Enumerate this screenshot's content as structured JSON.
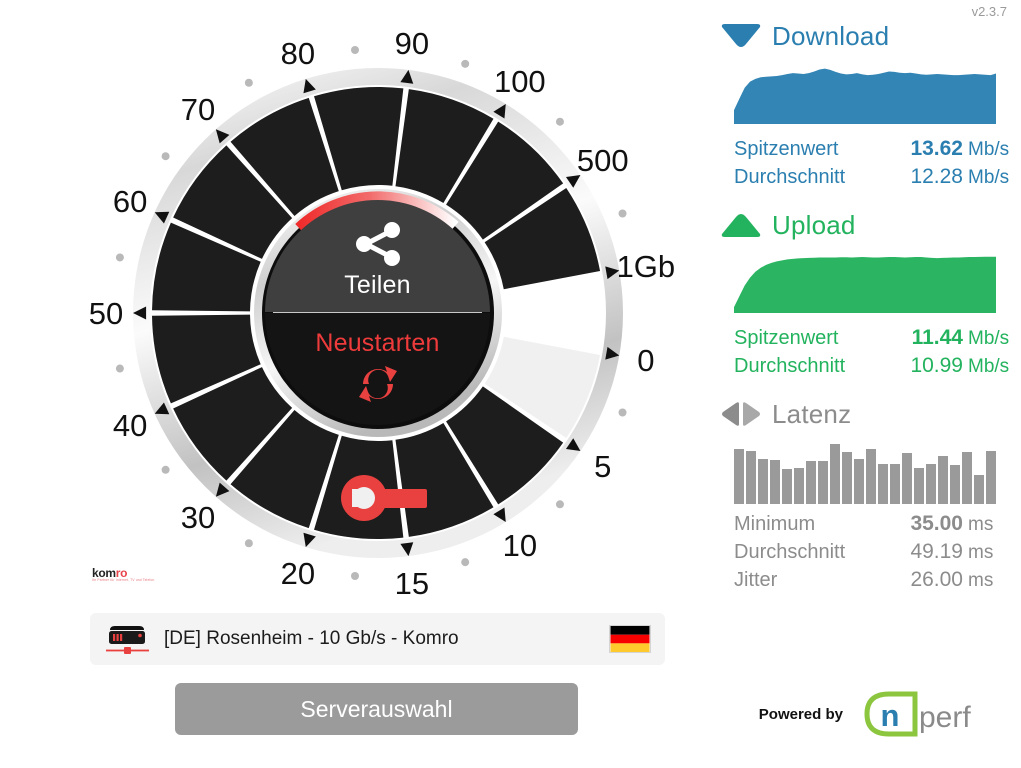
{
  "app": {
    "version": "v2.3.7",
    "powered_by_label": "Powered by",
    "brand_name": "nperf",
    "brand_n": "n",
    "brand_perf": "perf",
    "operator_logo_main": "kom",
    "operator_logo_accent": "ro",
    "operator_logo_tagline": "Ihr Partner für Internet, TV und Telefon"
  },
  "colors": {
    "download": "#2b7fb0",
    "download_fill": "#3385b5",
    "upload": "#23b35e",
    "upload_fill": "#2bb562",
    "latency": "#8c8c8c",
    "latency_fill": "#9a9a9a",
    "accent_red": "#ef3b3b",
    "button_grey": "#9b9b9b",
    "dial_dark": "#1d1d1d",
    "dial_light": "#f0f0f0"
  },
  "gauge": {
    "share_label": "Teilen",
    "share_icon": "share-icon",
    "restart_label": "Neustarten",
    "restart_icon": "refresh-icon",
    "settings_icon": "wrench-icon",
    "scale_labels": [
      "0",
      "5",
      "10",
      "15",
      "20",
      "30",
      "40",
      "50",
      "60",
      "70",
      "80",
      "90",
      "100",
      "500",
      "1Gb"
    ],
    "needle_value_label": ""
  },
  "results": {
    "download": {
      "title": "Download",
      "icon": "download-triangle-icon",
      "peak_label": "Spitzenwert",
      "peak_value": "13.62",
      "peak_unit": "Mb/s",
      "avg_label": "Durchschnitt",
      "avg_value": "12.28",
      "avg_unit": "Mb/s"
    },
    "upload": {
      "title": "Upload",
      "icon": "upload-triangle-icon",
      "peak_label": "Spitzenwert",
      "peak_value": "11.44",
      "peak_unit": "Mb/s",
      "avg_label": "Durchschnitt",
      "avg_value": "10.99",
      "avg_unit": "Mb/s"
    },
    "latency": {
      "title": "Latenz",
      "icon": "latency-arrows-icon",
      "min_label": "Minimum",
      "min_value": "35.00",
      "min_unit": "ms",
      "avg_label": "Durchschnitt",
      "avg_value": "49.19",
      "avg_unit": "ms",
      "jitter_label": "Jitter",
      "jitter_value": "26.00",
      "jitter_unit": "ms"
    }
  },
  "server": {
    "name": "[DE] Rosenheim - 10 Gb/s - Komro",
    "icon": "server-icon",
    "flag": "flag-de-icon",
    "select_button_label": "Serverauswahl"
  },
  "chart_data": [
    {
      "type": "area",
      "title": "Download",
      "ylabel": "Mb/s",
      "color": "#3385b5",
      "ylim": [
        0,
        14.5
      ],
      "values": [
        3.4,
        6.2,
        8.9,
        10.4,
        11.1,
        11.5,
        11.6,
        11.7,
        11.8,
        12.0,
        12.3,
        12.5,
        12.4,
        12.3,
        12.5,
        12.9,
        13.4,
        13.62,
        13.3,
        12.8,
        12.4,
        12.2,
        12.3,
        12.5,
        12.2,
        12.0,
        12.1,
        12.3,
        12.6,
        12.9,
        12.8,
        12.6,
        12.5,
        12.6,
        12.4,
        12.2,
        12.1,
        12.2,
        12.3,
        12.2,
        12.1,
        12.0,
        12.0,
        12.1,
        12.2,
        12.3,
        12.2,
        12.1,
        12.0,
        12.4
      ]
    },
    {
      "type": "area",
      "title": "Upload",
      "ylabel": "Mb/s",
      "color": "#2bb562",
      "ylim": [
        0,
        12
      ],
      "values": [
        1.2,
        3.4,
        5.6,
        7.2,
        8.4,
        9.2,
        9.8,
        10.2,
        10.5,
        10.7,
        10.9,
        11.0,
        11.1,
        11.15,
        11.2,
        11.25,
        11.3,
        11.3,
        11.3,
        11.3,
        11.35,
        11.35,
        11.3,
        11.35,
        11.4,
        11.35,
        11.3,
        11.3,
        11.35,
        11.4,
        11.4,
        11.35,
        11.3,
        11.35,
        11.4,
        11.4,
        11.3,
        11.2,
        11.15,
        11.2,
        11.25,
        11.3,
        11.3,
        11.35,
        11.4,
        11.4,
        11.42,
        11.44,
        11.44,
        11.44
      ]
    },
    {
      "type": "bar",
      "title": "Latenz",
      "ylabel": "ms",
      "color": "#9a9a9a",
      "ylim": [
        0,
        75
      ],
      "values": [
        66,
        64,
        55,
        53,
        42,
        43,
        52,
        52,
        72,
        63,
        55,
        67,
        48,
        48,
        62,
        44,
        49,
        58,
        47,
        63,
        35,
        64
      ]
    }
  ]
}
